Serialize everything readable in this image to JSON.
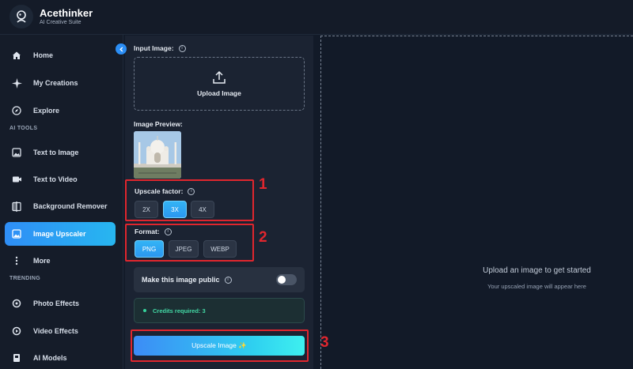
{
  "app": {
    "brand_name": "Acethinker",
    "brand_sub": "AI Creative Suite"
  },
  "sidebar": {
    "items": [
      {
        "label": "Home",
        "icon": "home-icon"
      },
      {
        "label": "My Creations",
        "icon": "sparkle-icon"
      },
      {
        "label": "Explore",
        "icon": "compass-icon"
      }
    ],
    "ai_tools_label": "AI TOOLS",
    "tools": [
      {
        "label": "Text to Image",
        "icon": "image-icon"
      },
      {
        "label": "Text to Video",
        "icon": "video-icon"
      },
      {
        "label": "Background Remover",
        "icon": "split-icon"
      },
      {
        "label": "Image Upscaler",
        "icon": "upscale-icon",
        "active": true
      },
      {
        "label": "More",
        "icon": "more-vertical-icon"
      }
    ],
    "trending_label": "TRENDING",
    "trending": [
      {
        "label": "Photo Effects",
        "icon": "photo-effects-icon"
      },
      {
        "label": "Video Effects",
        "icon": "video-effects-icon"
      },
      {
        "label": "AI Models",
        "icon": "ai-models-icon"
      }
    ]
  },
  "panel": {
    "input_label": "Input Image:",
    "upload_label": "Upload Image",
    "preview_label": "Image Preview:",
    "upscale_label": "Upscale factor:",
    "upscale_options": [
      "2X",
      "3X",
      "4X"
    ],
    "upscale_selected": "3X",
    "format_label": "Format:",
    "format_options": [
      "PNG",
      "JPEG",
      "WEBP"
    ],
    "format_selected": "PNG",
    "public_label": "Make this image public",
    "public_enabled": false,
    "credits_label": "Credits required: 3",
    "upscale_button": "Upscale Image ✨"
  },
  "result": {
    "title": "Upload an image to get started",
    "subtitle": "Your upscaled image will appear here"
  },
  "annotations": [
    "1",
    "2",
    "3"
  ],
  "colors": {
    "accent": "#2b8ef5",
    "annotation": "#e0262e",
    "credits": "#43d9a5"
  }
}
